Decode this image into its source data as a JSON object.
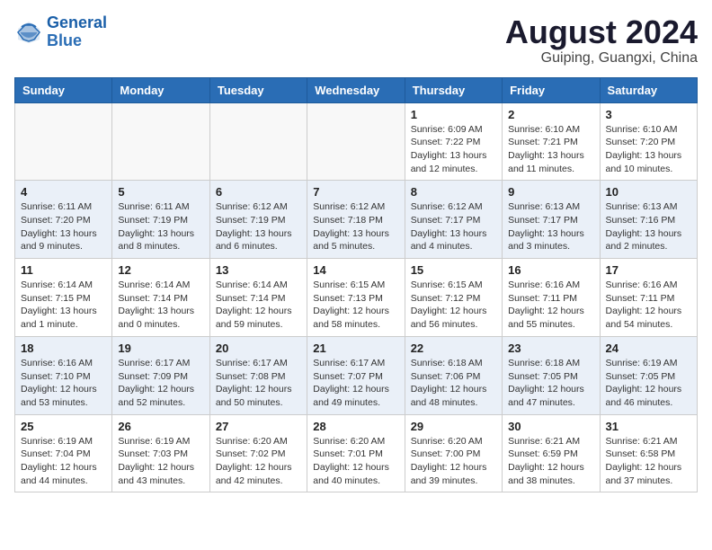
{
  "header": {
    "logo_line1": "General",
    "logo_line2": "Blue",
    "main_title": "August 2024",
    "subtitle": "Guiping, Guangxi, China"
  },
  "weekdays": [
    "Sunday",
    "Monday",
    "Tuesday",
    "Wednesday",
    "Thursday",
    "Friday",
    "Saturday"
  ],
  "weeks": [
    [
      {
        "day": "",
        "info": ""
      },
      {
        "day": "",
        "info": ""
      },
      {
        "day": "",
        "info": ""
      },
      {
        "day": "",
        "info": ""
      },
      {
        "day": "1",
        "info": "Sunrise: 6:09 AM\nSunset: 7:22 PM\nDaylight: 13 hours\nand 12 minutes."
      },
      {
        "day": "2",
        "info": "Sunrise: 6:10 AM\nSunset: 7:21 PM\nDaylight: 13 hours\nand 11 minutes."
      },
      {
        "day": "3",
        "info": "Sunrise: 6:10 AM\nSunset: 7:20 PM\nDaylight: 13 hours\nand 10 minutes."
      }
    ],
    [
      {
        "day": "4",
        "info": "Sunrise: 6:11 AM\nSunset: 7:20 PM\nDaylight: 13 hours\nand 9 minutes."
      },
      {
        "day": "5",
        "info": "Sunrise: 6:11 AM\nSunset: 7:19 PM\nDaylight: 13 hours\nand 8 minutes."
      },
      {
        "day": "6",
        "info": "Sunrise: 6:12 AM\nSunset: 7:19 PM\nDaylight: 13 hours\nand 6 minutes."
      },
      {
        "day": "7",
        "info": "Sunrise: 6:12 AM\nSunset: 7:18 PM\nDaylight: 13 hours\nand 5 minutes."
      },
      {
        "day": "8",
        "info": "Sunrise: 6:12 AM\nSunset: 7:17 PM\nDaylight: 13 hours\nand 4 minutes."
      },
      {
        "day": "9",
        "info": "Sunrise: 6:13 AM\nSunset: 7:17 PM\nDaylight: 13 hours\nand 3 minutes."
      },
      {
        "day": "10",
        "info": "Sunrise: 6:13 AM\nSunset: 7:16 PM\nDaylight: 13 hours\nand 2 minutes."
      }
    ],
    [
      {
        "day": "11",
        "info": "Sunrise: 6:14 AM\nSunset: 7:15 PM\nDaylight: 13 hours\nand 1 minute."
      },
      {
        "day": "12",
        "info": "Sunrise: 6:14 AM\nSunset: 7:14 PM\nDaylight: 13 hours\nand 0 minutes."
      },
      {
        "day": "13",
        "info": "Sunrise: 6:14 AM\nSunset: 7:14 PM\nDaylight: 12 hours\nand 59 minutes."
      },
      {
        "day": "14",
        "info": "Sunrise: 6:15 AM\nSunset: 7:13 PM\nDaylight: 12 hours\nand 58 minutes."
      },
      {
        "day": "15",
        "info": "Sunrise: 6:15 AM\nSunset: 7:12 PM\nDaylight: 12 hours\nand 56 minutes."
      },
      {
        "day": "16",
        "info": "Sunrise: 6:16 AM\nSunset: 7:11 PM\nDaylight: 12 hours\nand 55 minutes."
      },
      {
        "day": "17",
        "info": "Sunrise: 6:16 AM\nSunset: 7:11 PM\nDaylight: 12 hours\nand 54 minutes."
      }
    ],
    [
      {
        "day": "18",
        "info": "Sunrise: 6:16 AM\nSunset: 7:10 PM\nDaylight: 12 hours\nand 53 minutes."
      },
      {
        "day": "19",
        "info": "Sunrise: 6:17 AM\nSunset: 7:09 PM\nDaylight: 12 hours\nand 52 minutes."
      },
      {
        "day": "20",
        "info": "Sunrise: 6:17 AM\nSunset: 7:08 PM\nDaylight: 12 hours\nand 50 minutes."
      },
      {
        "day": "21",
        "info": "Sunrise: 6:17 AM\nSunset: 7:07 PM\nDaylight: 12 hours\nand 49 minutes."
      },
      {
        "day": "22",
        "info": "Sunrise: 6:18 AM\nSunset: 7:06 PM\nDaylight: 12 hours\nand 48 minutes."
      },
      {
        "day": "23",
        "info": "Sunrise: 6:18 AM\nSunset: 7:05 PM\nDaylight: 12 hours\nand 47 minutes."
      },
      {
        "day": "24",
        "info": "Sunrise: 6:19 AM\nSunset: 7:05 PM\nDaylight: 12 hours\nand 46 minutes."
      }
    ],
    [
      {
        "day": "25",
        "info": "Sunrise: 6:19 AM\nSunset: 7:04 PM\nDaylight: 12 hours\nand 44 minutes."
      },
      {
        "day": "26",
        "info": "Sunrise: 6:19 AM\nSunset: 7:03 PM\nDaylight: 12 hours\nand 43 minutes."
      },
      {
        "day": "27",
        "info": "Sunrise: 6:20 AM\nSunset: 7:02 PM\nDaylight: 12 hours\nand 42 minutes."
      },
      {
        "day": "28",
        "info": "Sunrise: 6:20 AM\nSunset: 7:01 PM\nDaylight: 12 hours\nand 40 minutes."
      },
      {
        "day": "29",
        "info": "Sunrise: 6:20 AM\nSunset: 7:00 PM\nDaylight: 12 hours\nand 39 minutes."
      },
      {
        "day": "30",
        "info": "Sunrise: 6:21 AM\nSunset: 6:59 PM\nDaylight: 12 hours\nand 38 minutes."
      },
      {
        "day": "31",
        "info": "Sunrise: 6:21 AM\nSunset: 6:58 PM\nDaylight: 12 hours\nand 37 minutes."
      }
    ]
  ]
}
